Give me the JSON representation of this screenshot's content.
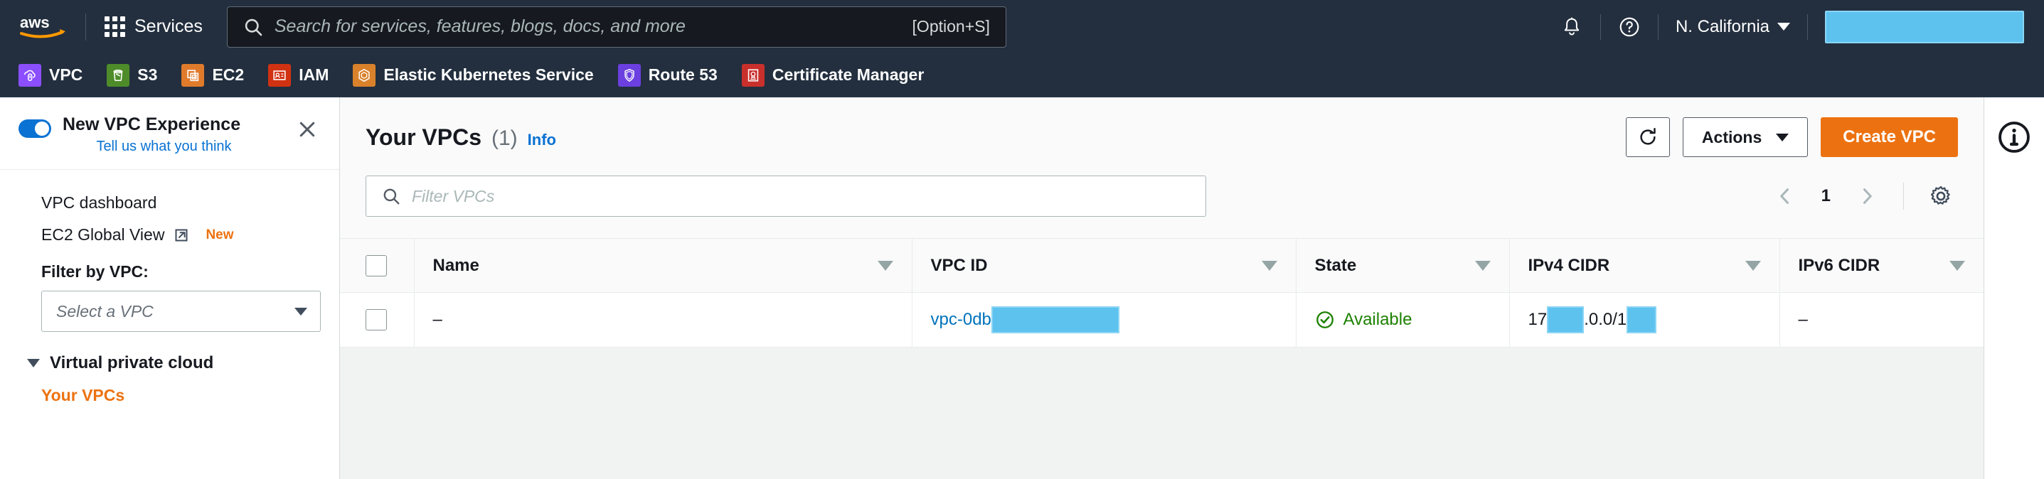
{
  "topnav": {
    "logo_name": "aws-logo",
    "services_label": "Services",
    "search": {
      "placeholder": "Search for services, features, blogs, docs, and more",
      "shortcut": "[Option+S]",
      "icon": "search-icon"
    },
    "notifications_icon": "bell-icon",
    "help_icon": "question-circle-icon",
    "region": "N. California",
    "account_redacted": "",
    "colors": {
      "bg": "#232f3e",
      "search_bg": "#16191f"
    }
  },
  "favorites": {
    "items": [
      {
        "label": "VPC",
        "icon": "vpc-icon",
        "color": "#8c4fff"
      },
      {
        "label": "S3",
        "icon": "s3-icon",
        "color": "#4e8c2a"
      },
      {
        "label": "EC2",
        "icon": "ec2-icon",
        "color": "#e07b2c"
      },
      {
        "label": "IAM",
        "icon": "iam-icon",
        "color": "#d13212"
      },
      {
        "label": "Elastic Kubernetes Service",
        "icon": "eks-icon",
        "color": "#d9822b"
      },
      {
        "label": "Route 53",
        "icon": "route53-icon",
        "color": "#6b3fe0"
      },
      {
        "label": "Certificate Manager",
        "icon": "acm-icon",
        "color": "#c9302c"
      }
    ]
  },
  "sidebar": {
    "experience_banner": {
      "title": "New VPC Experience",
      "subtitle": "Tell us what you think",
      "toggle_on": true,
      "close_icon": "close-icon"
    },
    "links": [
      {
        "label": "VPC dashboard",
        "external": false,
        "badge": ""
      },
      {
        "label": "EC2 Global View",
        "external": true,
        "badge": "New"
      }
    ],
    "filter_label": "Filter by VPC:",
    "filter_select_placeholder": "Select a VPC",
    "group_label": "Virtual private cloud",
    "active_item": "Your VPCs"
  },
  "main": {
    "title": "Your VPCs",
    "count": "(1)",
    "info_label": "Info",
    "buttons": {
      "refresh_icon": "refresh-icon",
      "actions_label": "Actions",
      "create_label": "Create VPC"
    },
    "filter_placeholder": "Filter VPCs",
    "pagination": {
      "prev_icon": "chevron-left-icon",
      "page": "1",
      "next_icon": "chevron-right-icon",
      "settings_icon": "gear-icon"
    },
    "table": {
      "columns": [
        "Name",
        "VPC ID",
        "State",
        "IPv4 CIDR",
        "IPv6 CIDR"
      ],
      "rows": [
        {
          "name": "–",
          "vpc_id_prefix": "vpc-0db",
          "vpc_id_redacted": true,
          "state": "Available",
          "state_icon": "check-circle-icon",
          "ipv4_part1": "17",
          "ipv4_part2": ".0.0/1",
          "ipv6": "–"
        }
      ]
    },
    "right_rail_info_icon": "info-circle-icon"
  },
  "colors": {
    "accent_orange": "#ec7211",
    "link_blue": "#0073bb",
    "success_green": "#1d8102",
    "redaction": "#5ec2ef"
  }
}
